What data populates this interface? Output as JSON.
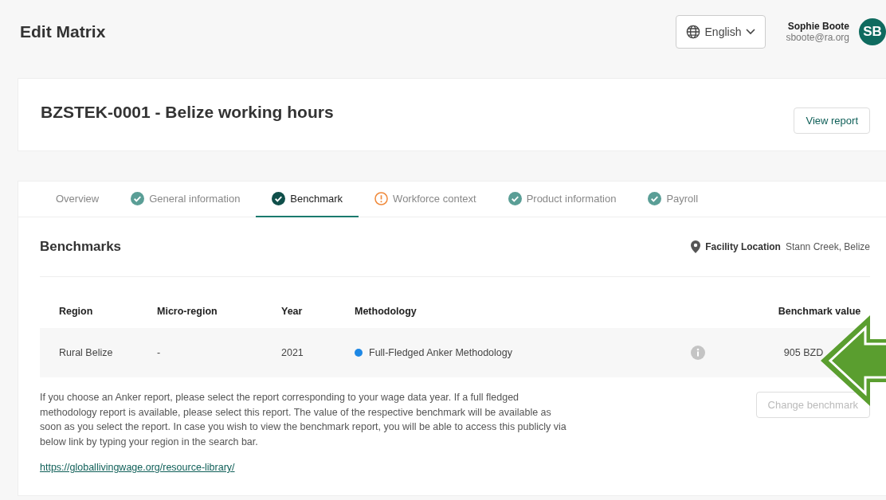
{
  "page_title": "Edit Matrix",
  "language": {
    "label": "English"
  },
  "user": {
    "name": "Sophie Boote",
    "email": "sboote@ra.org",
    "initials": "SB"
  },
  "matrix": {
    "title": "BZSTEK-0001 - Belize working hours",
    "view_button": "View report"
  },
  "tabs": [
    {
      "label": "Overview",
      "kind": "plain",
      "selected": false
    },
    {
      "label": "General information",
      "kind": "done",
      "selected": false
    },
    {
      "label": "Benchmark",
      "kind": "done",
      "selected": true
    },
    {
      "label": "Workforce context",
      "kind": "warning",
      "selected": false
    },
    {
      "label": "Product information",
      "kind": "done",
      "selected": false
    },
    {
      "label": "Payroll",
      "kind": "done",
      "selected": false
    }
  ],
  "benchmarks": {
    "title": "Benchmarks",
    "location_label": "Facility Location",
    "location_value": "Stann Creek, Belize",
    "columns": [
      "Region",
      "Micro-region",
      "Year",
      "Methodology",
      "Benchmark value"
    ],
    "rows": [
      {
        "region": "Rural Belize",
        "micro_region": "-",
        "year": "2021",
        "methodology": "Full-Fledged Anker Methodology",
        "color": "#1e88e5",
        "value": "905 BZD"
      }
    ],
    "change_button": {
      "label": "Change benchmark",
      "disabled": true
    },
    "note": "If you choose an Anker report, please select the report corresponding to your wage data year. If a full fledged methodology report is available, please select this report. The value of the respective benchmark will be available as soon as you select the report. In case you wish to view the benchmark report, you will be able to access this publicly via below link by typing your region in the search bar.",
    "link": "https://globallivingwage.org/resource-library/"
  }
}
